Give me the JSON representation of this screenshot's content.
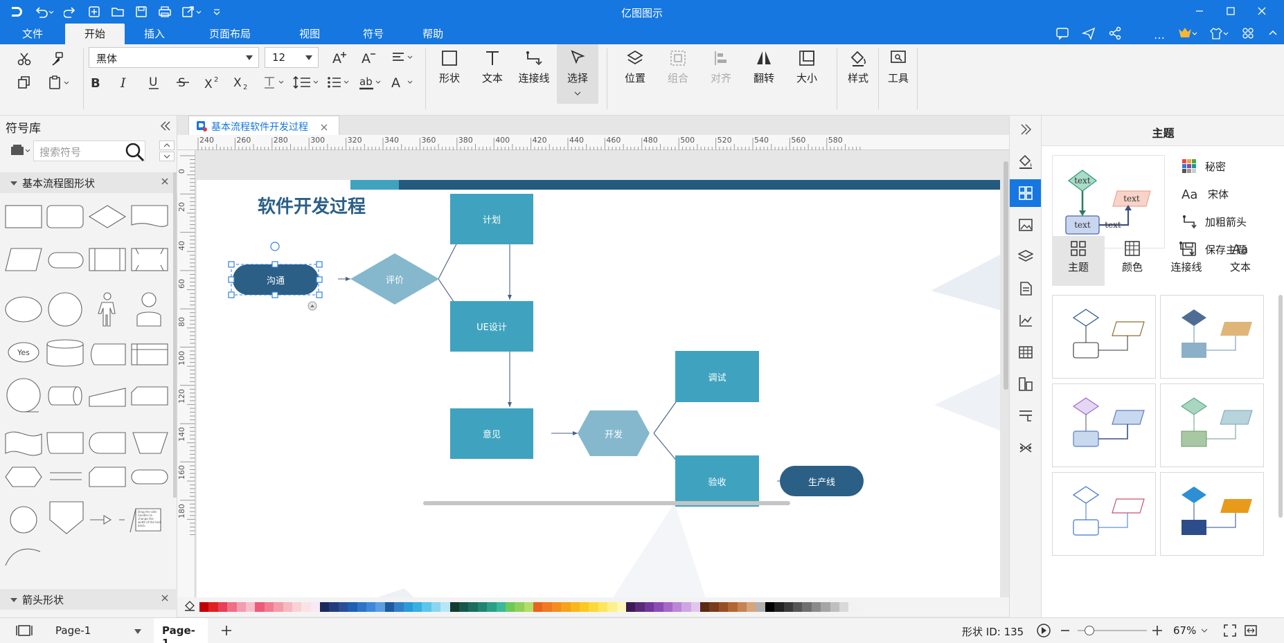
{
  "app": {
    "title": "亿图图示"
  },
  "menu": {
    "items": [
      "文件",
      "开始",
      "插入",
      "页面布局",
      "视图",
      "符号",
      "帮助"
    ],
    "active": "开始"
  },
  "ribbon": {
    "font_name": "黑体",
    "font_size": "12",
    "shape_label": "形状",
    "text_label": "文本",
    "connector_label": "连接线",
    "select_label": "选择",
    "position_label": "位置",
    "group_label": "组合",
    "align_label": "对齐",
    "flip_label": "翻转",
    "size_label": "大小",
    "style_label": "样式",
    "tools_label": "工具"
  },
  "symbols": {
    "title": "符号库",
    "search_placeholder": "搜索符号",
    "section1": "基本流程图形状",
    "section2": "箭头形状",
    "yes_label": "Yes",
    "note_text": "Drag the side handles to change the width of the text block."
  },
  "document": {
    "tab_name": "基本流程软件开发过程",
    "ruler_h": [
      "240",
      "260",
      "280",
      "300",
      "320",
      "340",
      "360",
      "380",
      "400",
      "420",
      "440",
      "460",
      "480",
      "500",
      "520",
      "540",
      "560",
      "580"
    ],
    "ruler_v": [
      "0",
      "20",
      "40",
      "60",
      "80",
      "100",
      "120",
      "140",
      "160",
      "180"
    ],
    "diagram_title": "软件开发过程",
    "nodes": {
      "communicate": "沟通",
      "evaluate": "评价",
      "plan": "计划",
      "ue_design": "UE设计",
      "feedback": "意见",
      "develop": "开发",
      "debug": "调试",
      "accept": "验收",
      "production": "生产线"
    }
  },
  "theme_panel": {
    "title": "主题",
    "preview_text": "text",
    "options": [
      "秘密",
      "宋体",
      "加粗箭头",
      "保存主题"
    ],
    "tabs": [
      "主题",
      "颜色",
      "连接线",
      "文本"
    ]
  },
  "status": {
    "page_selector": "Page-1",
    "page_tab": "Page-1",
    "shape_id": "形状 ID:  135",
    "zoom": "67%"
  },
  "colors": {
    "brand": "#1677e0",
    "node_dark": "#2b5f86",
    "node_mid": "#3fa3bf",
    "node_light": "#85b8cc"
  },
  "palette_colors": [
    "#c00000",
    "#e02020",
    "#e83e5a",
    "#ef6f86",
    "#f29db0",
    "#f5c0cc",
    "#ee5a7a",
    "#f07e90",
    "#f49ca8",
    "#f7b8c0",
    "#f9d2d6",
    "#fbe3e5",
    "#f7e9f5",
    "#1b2a5a",
    "#243d7a",
    "#2a4f97",
    "#1f5fb0",
    "#2f73c8",
    "#3d88d8",
    "#5b9fe2",
    "#1e5aa0",
    "#2f80c8",
    "#2b9ad8",
    "#35b0e0",
    "#5cc6ea",
    "#8ad6f0",
    "#b7e6f6",
    "#123b2d",
    "#16574a",
    "#1a6d5c",
    "#1f8570",
    "#2aa085",
    "#3cb89a",
    "#6cca58",
    "#8fd15a",
    "#b4dd6a",
    "#e8641e",
    "#ef7a22",
    "#f38d1e",
    "#f6a21c",
    "#f8b71b",
    "#fac922",
    "#fcd93a",
    "#fde55e",
    "#fdf08a",
    "#fef7b8",
    "#3d1a55",
    "#5a2a78",
    "#71379a",
    "#8c4bb4",
    "#a567c8",
    "#bb86d6",
    "#cfa6e2",
    "#e0c6ec",
    "#5a2a14",
    "#7a3b1c",
    "#974f25",
    "#b26634",
    "#c88352",
    "#d8a47c",
    "#b0b0b0",
    "#000000",
    "#222222",
    "#3a3a3a",
    "#555555",
    "#6f6f6f",
    "#8a8a8a",
    "#a5a5a5",
    "#bfbfbf",
    "#d9d9d9",
    "#f2f2f2"
  ]
}
